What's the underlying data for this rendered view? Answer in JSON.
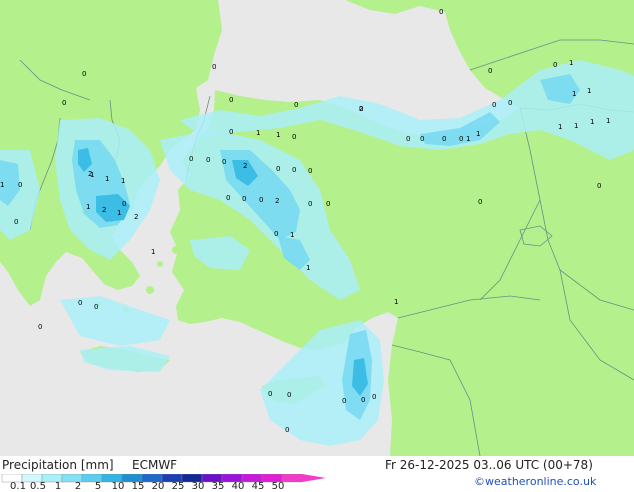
{
  "map": {
    "colors": {
      "sea": "#e8e8e8",
      "land": "#b4f08c",
      "border": "#6b8f86",
      "precip_light": "#aaeef8",
      "precip_mid": "#76d8f2",
      "precip_strong": "#3cbde6",
      "value_text": "#000000"
    },
    "value_labels": [
      "0",
      "0",
      "0",
      "0",
      "0",
      "0",
      "0",
      "0",
      "0",
      "0",
      "0",
      "0",
      "0",
      "0",
      "0",
      "0",
      "0",
      "0",
      "0",
      "0",
      "0",
      "0",
      "0",
      "0",
      "0",
      "0",
      "0",
      "0",
      "0",
      "0",
      "0",
      "0",
      "0",
      "0",
      "1",
      "1",
      "1",
      "1",
      "1",
      "1",
      "1",
      "1",
      "1",
      "1",
      "1",
      "1",
      "1",
      "1",
      "1",
      "1",
      "1",
      "1",
      "1",
      "1",
      "1",
      "2",
      "2",
      "2",
      "2",
      "2",
      "2",
      "0",
      "0",
      "0",
      "0",
      "0",
      "0",
      "0",
      "0",
      "0"
    ]
  },
  "footer": {
    "title": "Precipitation [mm]",
    "model": "ECMWF",
    "valid_time": "Fr 26-12-2025 03..06 UTC (00+78)",
    "credit": "©weatheronline.co.uk",
    "legend_ticks": [
      "0.1",
      "0.5",
      "1",
      "2",
      "5",
      "10",
      "15",
      "20",
      "25",
      "30",
      "35",
      "40",
      "45",
      "50"
    ],
    "legend_colors": [
      "#ffffff",
      "#d2f8fc",
      "#aaeef8",
      "#86e0f4",
      "#5ccdee",
      "#32b4e4",
      "#1f8fd2",
      "#2068c8",
      "#1a40b4",
      "#142896",
      "#6a12c8",
      "#9c14d8",
      "#c818dc",
      "#e21ed4",
      "#f03cc8"
    ]
  }
}
